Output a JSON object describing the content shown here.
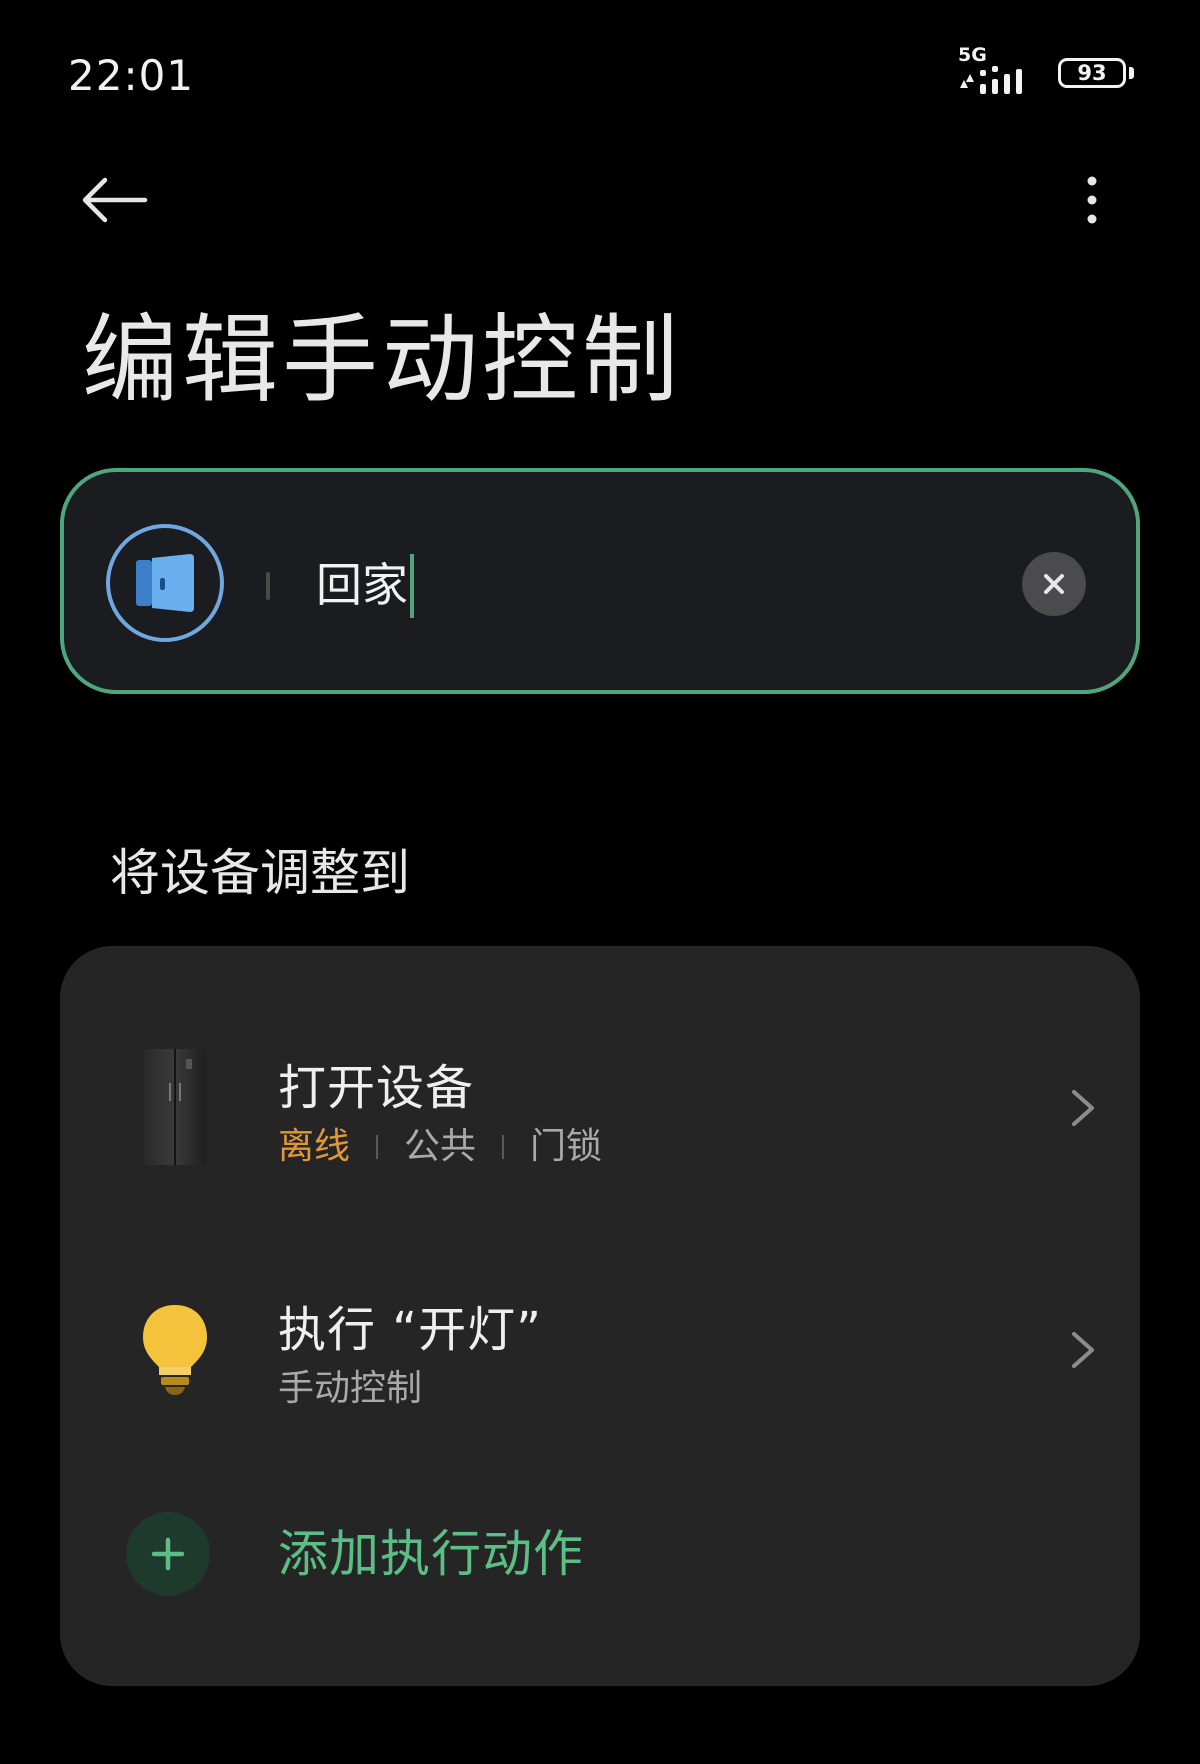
{
  "status_bar": {
    "time": "22:01",
    "network": "5G",
    "battery": "93"
  },
  "app_bar": {
    "back_icon": "arrow-left-icon",
    "more_icon": "more-vertical-icon"
  },
  "page": {
    "title": "编辑手动控制"
  },
  "scene_name": {
    "icon": "door-icon",
    "value": "回家",
    "clear_icon": "close-icon",
    "accent_color": "#4fa57c"
  },
  "section": {
    "title": "将设备调整到"
  },
  "actions": [
    {
      "icon": "refrigerator-icon",
      "title": "打开设备",
      "status": "离线",
      "status_color": "#e0973a",
      "room": "公共",
      "device_type": "门锁"
    },
    {
      "icon": "lightbulb-icon",
      "title": "执行 “开灯”",
      "subtitle": "手动控制"
    }
  ],
  "add_action": {
    "icon": "plus-icon",
    "label": "添加执行动作",
    "color": "#5bbf85"
  }
}
